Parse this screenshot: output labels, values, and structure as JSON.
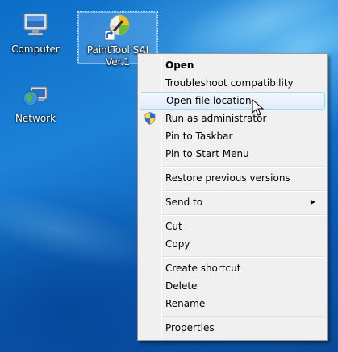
{
  "desktop": {
    "icons": [
      {
        "label": "Computer",
        "icon": "computer-icon"
      },
      {
        "label": "PaintTool SAI Ver.1",
        "icon": "painttool-sai-icon",
        "selected": true
      },
      {
        "label": "Network",
        "icon": "network-icon"
      }
    ]
  },
  "context_menu": {
    "items": [
      {
        "label": "Open",
        "bold": true
      },
      {
        "label": "Troubleshoot compatibility"
      },
      {
        "label": "Open file location",
        "highlighted": true
      },
      {
        "label": "Run as administrator",
        "icon": "uac-shield-icon"
      },
      {
        "label": "Pin to Taskbar"
      },
      {
        "label": "Pin to Start Menu"
      },
      {
        "label": "Restore previous versions"
      },
      {
        "label": "Send to",
        "submenu": true,
        "submenu_icon": "chevron-right-icon"
      },
      {
        "label": "Cut"
      },
      {
        "label": "Copy"
      },
      {
        "label": "Create shortcut"
      },
      {
        "label": "Delete"
      },
      {
        "label": "Rename"
      },
      {
        "label": "Properties"
      }
    ],
    "submenu_arrow": "▶"
  },
  "colors": {
    "desktop_blue": "#1c82d8",
    "menu_background": "#f0f0f0",
    "highlight_border": "#a8d8eb"
  }
}
